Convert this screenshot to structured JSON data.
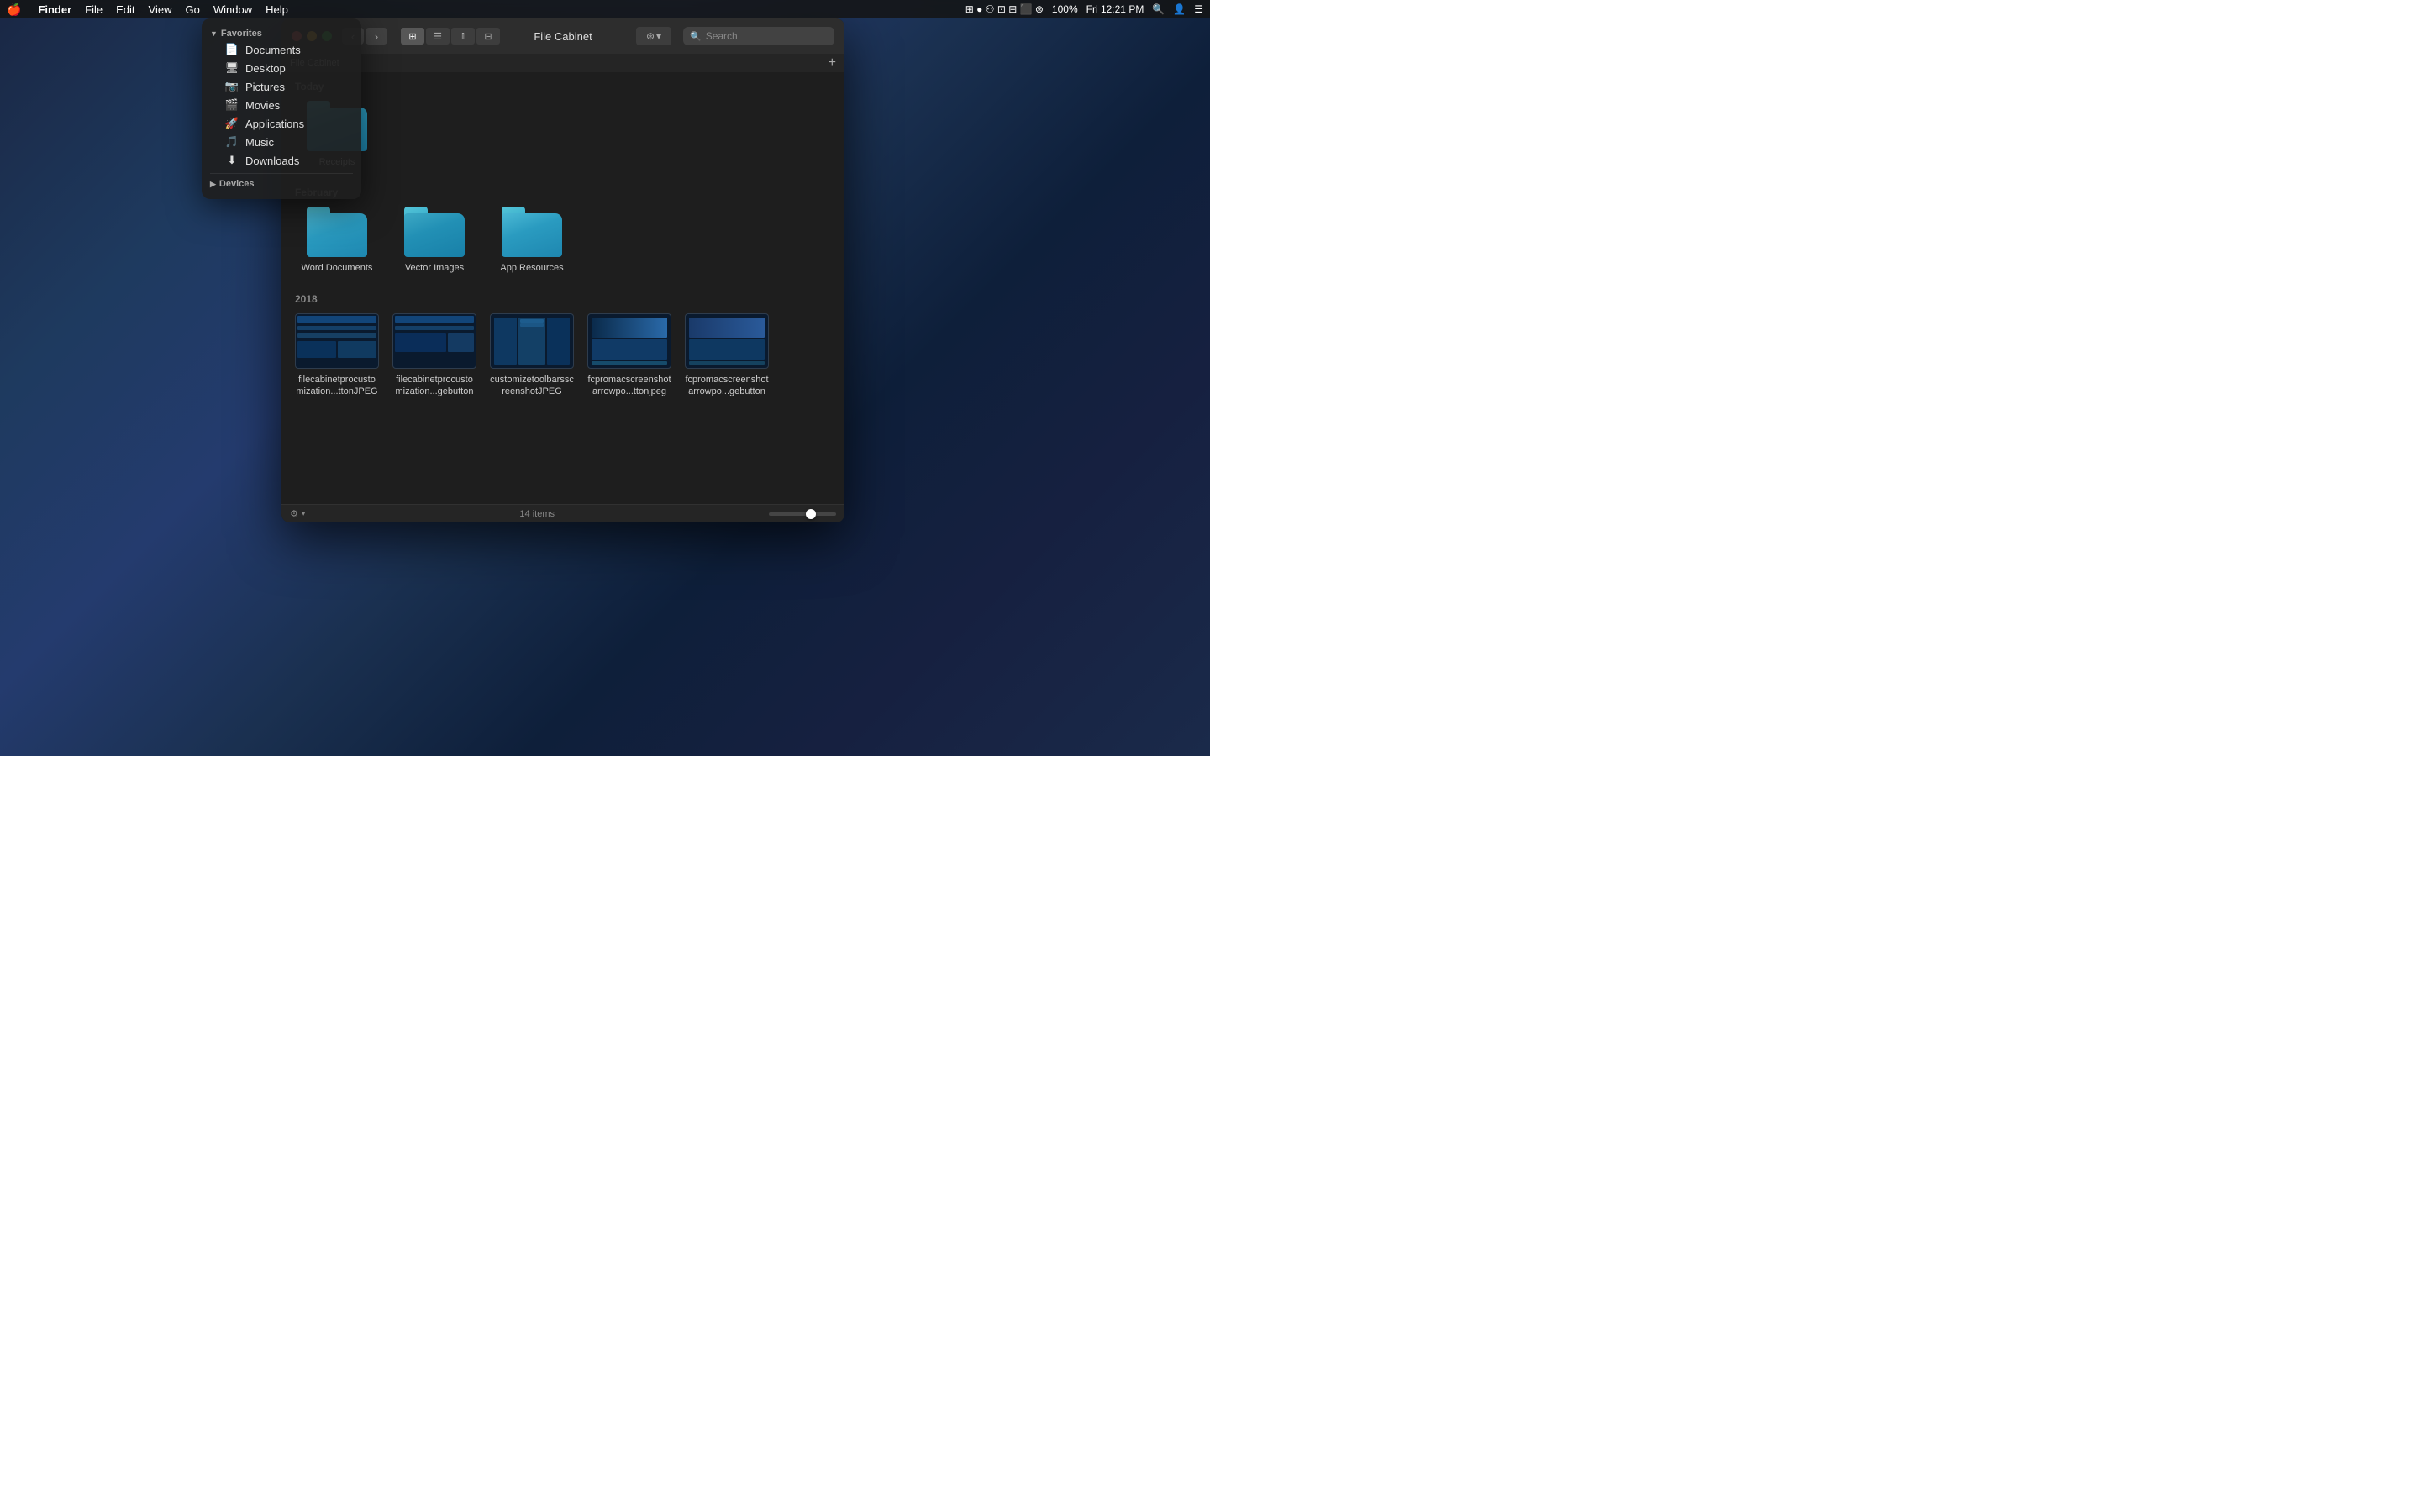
{
  "menubar": {
    "apple": "🍎",
    "finder": "Finder",
    "menus": [
      "File",
      "Edit",
      "View",
      "Go",
      "Window",
      "Help"
    ],
    "time": "Fri 12:21 PM",
    "battery": "100%",
    "wifi": "WiFi"
  },
  "sidebar": {
    "favorites_label": "Favorites",
    "items": [
      {
        "id": "documents",
        "label": "Documents",
        "icon": "📄"
      },
      {
        "id": "desktop",
        "label": "Desktop",
        "icon": "🖥"
      },
      {
        "id": "pictures",
        "label": "Pictures",
        "icon": "📷"
      },
      {
        "id": "movies",
        "label": "Movies",
        "icon": "🎬"
      },
      {
        "id": "applications",
        "label": "Applications",
        "icon": "🚀"
      },
      {
        "id": "music",
        "label": "Music",
        "icon": "🎵"
      },
      {
        "id": "downloads",
        "label": "Downloads",
        "icon": "⬇"
      }
    ],
    "devices_label": "Devices"
  },
  "finder": {
    "title": "File Cabinet",
    "pathbar_label": "File Cabinet",
    "search_placeholder": "Search",
    "items_count": "14 items",
    "sections": {
      "today": {
        "label": "Today",
        "items": [
          {
            "id": "receipts",
            "label": "Receipts",
            "type": "folder"
          }
        ]
      },
      "february": {
        "label": "February",
        "items": [
          {
            "id": "word-documents",
            "label": "Word Documents",
            "type": "folder"
          },
          {
            "id": "vector-images",
            "label": "Vector Images",
            "type": "folder"
          },
          {
            "id": "app-resources",
            "label": "App Resources",
            "type": "folder"
          }
        ]
      },
      "year2018": {
        "label": "2018",
        "items": [
          {
            "id": "file1",
            "label": "filecabinetprocustomization...ttonJPEG",
            "type": "image"
          },
          {
            "id": "file2",
            "label": "filecabinetprocustomization...gebutton",
            "type": "image"
          },
          {
            "id": "file3",
            "label": "customizetoolbarsscreenshotJPEG",
            "type": "image"
          },
          {
            "id": "file4",
            "label": "fcpromacscreenshotarrowpo...ttonjpeg",
            "type": "image"
          },
          {
            "id": "file5",
            "label": "fcpromacscreenshotarrowpo...gebutton",
            "type": "image"
          }
        ]
      }
    }
  }
}
